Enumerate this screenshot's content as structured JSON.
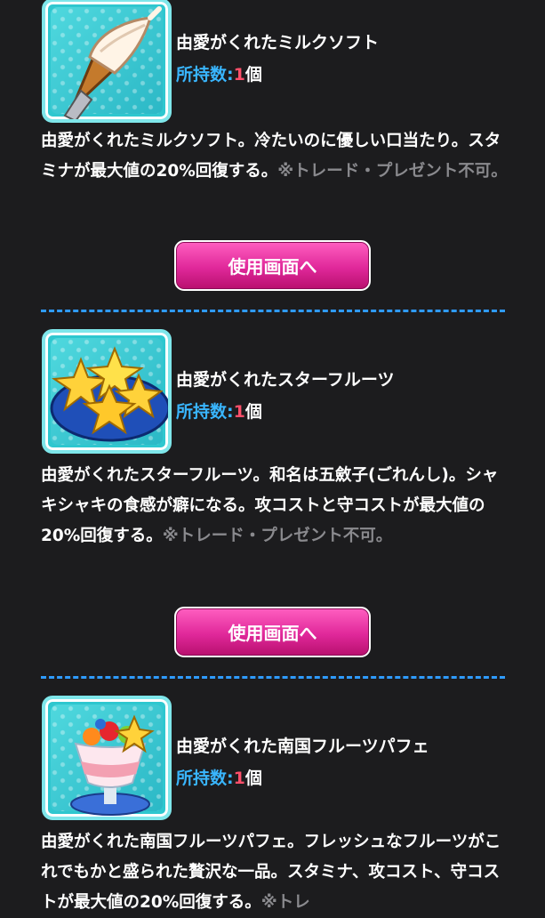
{
  "items": [
    {
      "name": "由愛がくれたミルクソフト",
      "count_label": "所持数:",
      "count_value": "1",
      "count_unit": "個",
      "desc_main": "由愛がくれたミルクソフト。冷たいのに優しい口当たり。スタミナが最大値の20%回復する。",
      "desc_note": "※トレード・プレゼント不可。",
      "button_label": "使用画面へ",
      "icon": "soft-serve-icon"
    },
    {
      "name": "由愛がくれたスターフルーツ",
      "count_label": "所持数:",
      "count_value": "1",
      "count_unit": "個",
      "desc_main": "由愛がくれたスターフルーツ。和名は五斂子(ごれんし)。シャキシャキの食感が癖になる。攻コストと守コストが最大値の20%回復する。",
      "desc_note": "※トレード・プレゼント不可。",
      "button_label": "使用画面へ",
      "icon": "star-fruit-icon"
    },
    {
      "name": "由愛がくれた南国フルーツパフェ",
      "count_label": "所持数:",
      "count_value": "1",
      "count_unit": "個",
      "desc_main": "由愛がくれた南国フルーツパフェ。フレッシュなフルーツがこれでもかと盛られた贅沢な一品。スタミナ、攻コスト、守コストが最大値の20%回復する。",
      "desc_note": "※トレ",
      "icon": "fruit-parfait-icon"
    }
  ],
  "colors": {
    "accent_blue": "#39b6ff",
    "count_red": "#ff4f6a",
    "button_pink": "#e0289a",
    "separator": "#2f9bff"
  }
}
